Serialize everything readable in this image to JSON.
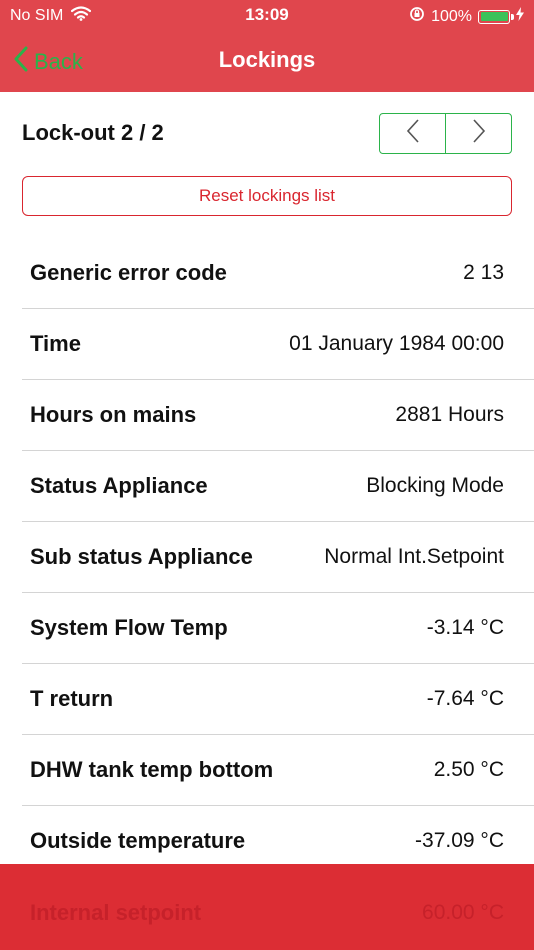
{
  "status_bar": {
    "carrier": "No SIM",
    "time": "13:09",
    "battery_percent": "100%",
    "battery_level": 1.0
  },
  "nav": {
    "back_label": "Back",
    "title": "Lockings"
  },
  "lockout": {
    "heading": "Lock-out 2 / 2",
    "reset_label": "Reset lockings list"
  },
  "rows": [
    {
      "label": "Generic error code",
      "value": "2 13"
    },
    {
      "label": "Time",
      "value": "01 January 1984 00:00"
    },
    {
      "label": "Hours on mains",
      "value": "2881 Hours"
    },
    {
      "label": "Status Appliance",
      "value": "Blocking Mode"
    },
    {
      "label": "Sub status Appliance",
      "value": "Normal Int.Setpoint"
    },
    {
      "label": "System Flow Temp",
      "value": "-3.14 °C"
    },
    {
      "label": "T return",
      "value": "-7.64 °C"
    },
    {
      "label": "DHW tank temp bottom",
      "value": "2.50 °C"
    },
    {
      "label": "Outside temperature",
      "value": "-37.09 °C"
    },
    {
      "label": "Internal setpoint",
      "value": "60.00 °C"
    }
  ],
  "colors": {
    "header_red": "#e0464d",
    "accent_green": "#2bb34a",
    "reset_red": "#d9262f",
    "bottom_bar_red": "#dc2d34"
  }
}
